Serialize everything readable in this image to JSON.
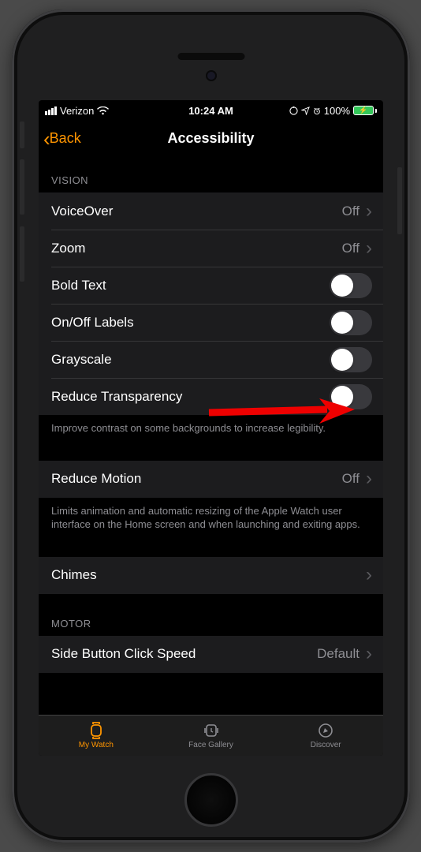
{
  "status": {
    "carrier": "Verizon",
    "time": "10:24 AM",
    "battery_pct": "100%"
  },
  "nav": {
    "back": "Back",
    "title": "Accessibility"
  },
  "sections": {
    "vision_header": "VISION",
    "motor_header": "MOTOR",
    "voiceover": {
      "label": "VoiceOver",
      "value": "Off"
    },
    "zoom": {
      "label": "Zoom",
      "value": "Off"
    },
    "bold_text": {
      "label": "Bold Text"
    },
    "onoff_labels": {
      "label": "On/Off Labels"
    },
    "grayscale": {
      "label": "Grayscale"
    },
    "reduce_transparency": {
      "label": "Reduce Transparency"
    },
    "transparency_footer": "Improve contrast on some backgrounds to increase legibility.",
    "reduce_motion": {
      "label": "Reduce Motion",
      "value": "Off"
    },
    "motion_footer": "Limits animation and automatic resizing of the Apple Watch user interface on the Home screen and when launching and exiting apps.",
    "chimes": {
      "label": "Chimes"
    },
    "side_button": {
      "label": "Side Button Click Speed",
      "value": "Default"
    }
  },
  "tabs": {
    "my_watch": "My Watch",
    "face_gallery": "Face Gallery",
    "discover": "Discover"
  }
}
